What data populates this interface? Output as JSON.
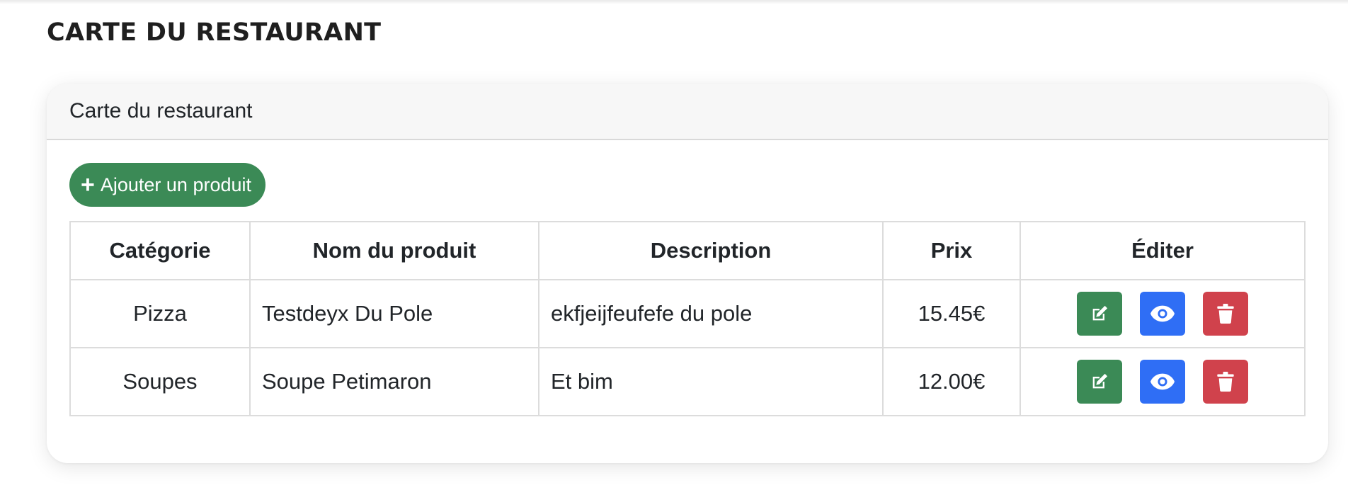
{
  "page": {
    "title": "CARTE DU RESTAURANT"
  },
  "card": {
    "header": "Carte du restaurant",
    "add_button_label": "Ajouter un produit"
  },
  "table": {
    "headers": [
      "Catégorie",
      "Nom du produit",
      "Description",
      "Prix",
      "Éditer"
    ],
    "rows": [
      {
        "category": "Pizza",
        "name": "Testdeyx Du Pole",
        "description": "ekfjeijfeufefe du pole",
        "price": "15.45€"
      },
      {
        "category": "Soupes",
        "name": "Soupe Petimaron",
        "description": "Et bim",
        "price": "12.00€"
      }
    ],
    "actions": [
      {
        "icon": "edit-icon",
        "color": "#3b8a56"
      },
      {
        "icon": "eye-icon",
        "color": "#2f6ef5"
      },
      {
        "icon": "trash-icon",
        "color": "#d0424c"
      }
    ]
  },
  "colors": {
    "success": "#3b8a56",
    "primary": "#2f6ef5",
    "danger": "#d0424c"
  }
}
